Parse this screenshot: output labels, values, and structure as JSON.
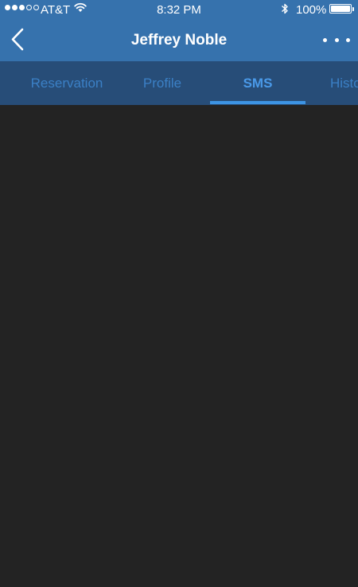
{
  "status_bar": {
    "carrier": "AT&T",
    "time": "8:32 PM",
    "battery_percent": "100%",
    "battery_level": 1.0,
    "signal_bars_filled": 3,
    "signal_bars_total": 5
  },
  "nav": {
    "title": "Jeffrey Noble",
    "back_icon": "chevron-left-icon",
    "more_icon": "more-horizontal-icon"
  },
  "tabs": [
    {
      "label": "Reservation",
      "active": false
    },
    {
      "label": "Profile",
      "active": false
    },
    {
      "label": "SMS",
      "active": true
    },
    {
      "label": "History",
      "active": false
    }
  ],
  "colors": {
    "header_blue": "#3672ad",
    "tab_strip": "#274d78",
    "tab_text": "#3b80c6",
    "tab_active_text": "#4a9ae9",
    "indicator": "#3d94e4",
    "content_bg": "#232323"
  }
}
